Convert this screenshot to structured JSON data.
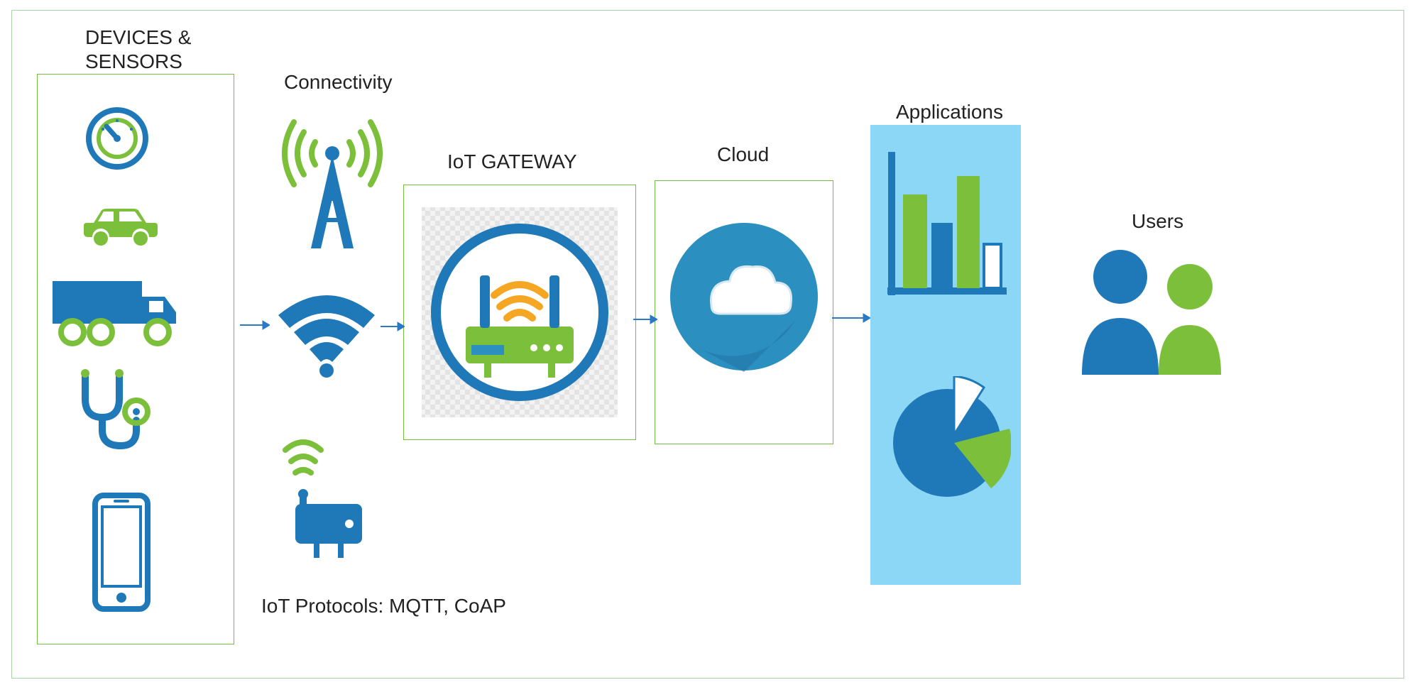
{
  "labels": {
    "devices": "DEVICES &\nSENSORS",
    "connectivity": "Connectivity",
    "gateway": "IoT GATEWAY",
    "cloud": "Cloud",
    "applications": "Applications",
    "users": "Users",
    "protocols": "IoT Protocols: MQTT, CoAP"
  },
  "colors": {
    "blue": "#1f78b8",
    "green": "#7bbf3a",
    "lightBlue": "#8cd7f5",
    "borderGreen": "#76bb44",
    "arrow": "#2b78c5"
  },
  "sections": [
    {
      "name": "devices-sensors",
      "icons": [
        "gauge",
        "car",
        "truck",
        "stethoscope",
        "smartphone"
      ]
    },
    {
      "name": "connectivity",
      "icons": [
        "cell-tower",
        "wifi",
        "router-wireless"
      ]
    },
    {
      "name": "iot-gateway",
      "icons": [
        "router-gateway"
      ]
    },
    {
      "name": "cloud",
      "icons": [
        "cloud"
      ]
    },
    {
      "name": "applications",
      "icons": [
        "bar-chart",
        "pie-chart"
      ]
    },
    {
      "name": "users",
      "icons": [
        "people"
      ]
    }
  ],
  "flow": [
    "devices-sensors",
    "connectivity",
    "iot-gateway",
    "cloud",
    "applications",
    "users"
  ]
}
